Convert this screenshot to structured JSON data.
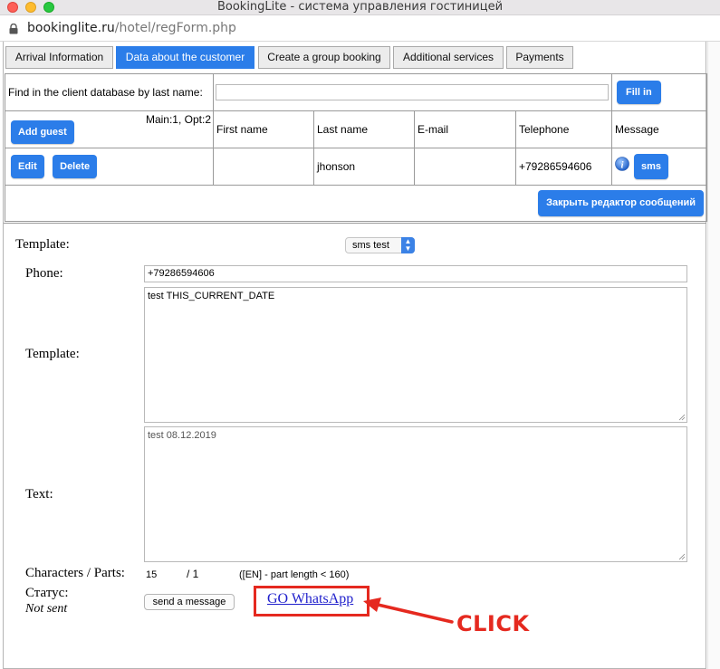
{
  "window": {
    "title": "BookingLite - система управления гостиницей"
  },
  "url": {
    "host": "bookinglite.ru",
    "path": "/hotel/regForm.php"
  },
  "tabs": [
    {
      "label": "Arrival Information",
      "active": false
    },
    {
      "label": "Data about the customer",
      "active": true
    },
    {
      "label": "Create a group booking",
      "active": false
    },
    {
      "label": "Additional services",
      "active": false
    },
    {
      "label": "Payments",
      "active": false
    }
  ],
  "search": {
    "label": "Find in the client database by last name:",
    "value": "",
    "fill_button": "Fill in"
  },
  "guests": {
    "add_button": "Add guest",
    "counts": "Main:1, Opt:2",
    "columns": [
      "First name",
      "Last name",
      "E-mail",
      "Telephone",
      "Message"
    ],
    "rows": [
      {
        "edit_button": "Edit",
        "delete_button": "Delete",
        "first_name": "",
        "last_name": "jhonson",
        "email": "",
        "telephone": "+79286594606",
        "sms_button": "sms",
        "info_icon": "info-icon"
      }
    ]
  },
  "editor": {
    "close_button": "Закрыть редактор сообщений",
    "template_label": "Template:",
    "template_select": "sms test",
    "phone_label": "Phone:",
    "phone_value": "+79286594606",
    "template_field_label": "Template:",
    "template_value": "test THIS_CURRENT_DATE",
    "text_label": "Text:",
    "text_value": "test 08.12.2019",
    "chars_label": "Characters / Parts:",
    "chars_value": "15",
    "parts_value": "/ 1",
    "part_length_note": "([EN] - part length < 160)",
    "status_label": "Статус:",
    "status_value": "Not sent",
    "send_button": "send a message",
    "whatsapp_link": "GO WhatsApp",
    "callout_label": "CLICK"
  },
  "colors": {
    "accent": "#2b7de9",
    "callout": "#e5291f",
    "link": "#1f1fcc"
  }
}
